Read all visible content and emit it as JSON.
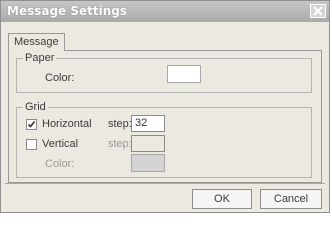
{
  "window": {
    "title": "Message Settings",
    "close_icon": "close-x-icon"
  },
  "tabs": [
    {
      "label": "Message",
      "active": true
    }
  ],
  "paper": {
    "legend": "Paper",
    "color_label": "Color:",
    "color_value": "#ffffff"
  },
  "grid": {
    "legend": "Grid",
    "horizontal": {
      "label": "Horizontal",
      "checked": true,
      "step_label": "step:",
      "step_value": "32"
    },
    "vertical": {
      "label": "Vertical",
      "checked": false,
      "step_label": "step:",
      "step_value": ""
    },
    "color_label": "Color:",
    "color_value": "#d4d4d4"
  },
  "buttons": {
    "ok": "OK",
    "cancel": "Cancel"
  }
}
